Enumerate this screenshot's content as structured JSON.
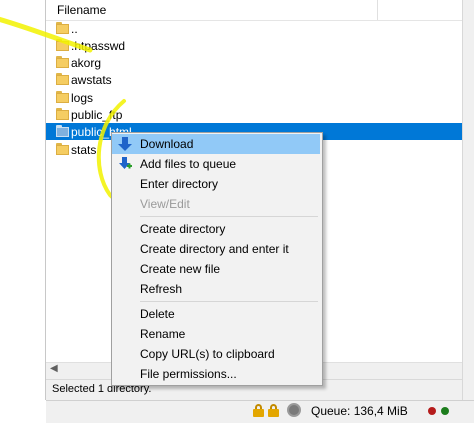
{
  "file_panel": {
    "column_header": "Filename",
    "files": [
      {
        "name": "..",
        "selected": false
      },
      {
        "name": ".htpasswd",
        "selected": false
      },
      {
        "name": "akorg",
        "selected": false
      },
      {
        "name": "awstats",
        "selected": false
      },
      {
        "name": "logs",
        "selected": false
      },
      {
        "name": "public_ftp",
        "selected": false
      },
      {
        "name": "public_html",
        "selected": true
      },
      {
        "name": "stats",
        "selected": false
      }
    ]
  },
  "context_menu": {
    "items": [
      {
        "label": "Download",
        "icon": "download-arrow-icon",
        "highlighted": true
      },
      {
        "label": "Add files to queue",
        "icon": "add-to-queue-icon"
      },
      {
        "label": "Enter directory"
      },
      {
        "label": "View/Edit",
        "disabled": true
      },
      {
        "label": "Create directory"
      },
      {
        "label": "Create directory and enter it"
      },
      {
        "label": "Create new file"
      },
      {
        "label": "Refresh"
      },
      {
        "label": "Delete"
      },
      {
        "label": "Rename"
      },
      {
        "label": "Copy URL(s) to clipboard"
      },
      {
        "label": "File permissions..."
      }
    ]
  },
  "status_bar": {
    "text": "Selected 1 directory.",
    "queue_label": "Queue: 136,4 MiB",
    "icons": [
      "lock-icon",
      "lock-icon",
      "gear-icon",
      "sync-icon"
    ],
    "lights": {
      "red": "#b51b1b",
      "green": "#1d7d1d"
    }
  },
  "colors": {
    "selection": "#0078d7",
    "menu_highlight": "#91c9f7",
    "annotation": "#f2f200"
  }
}
